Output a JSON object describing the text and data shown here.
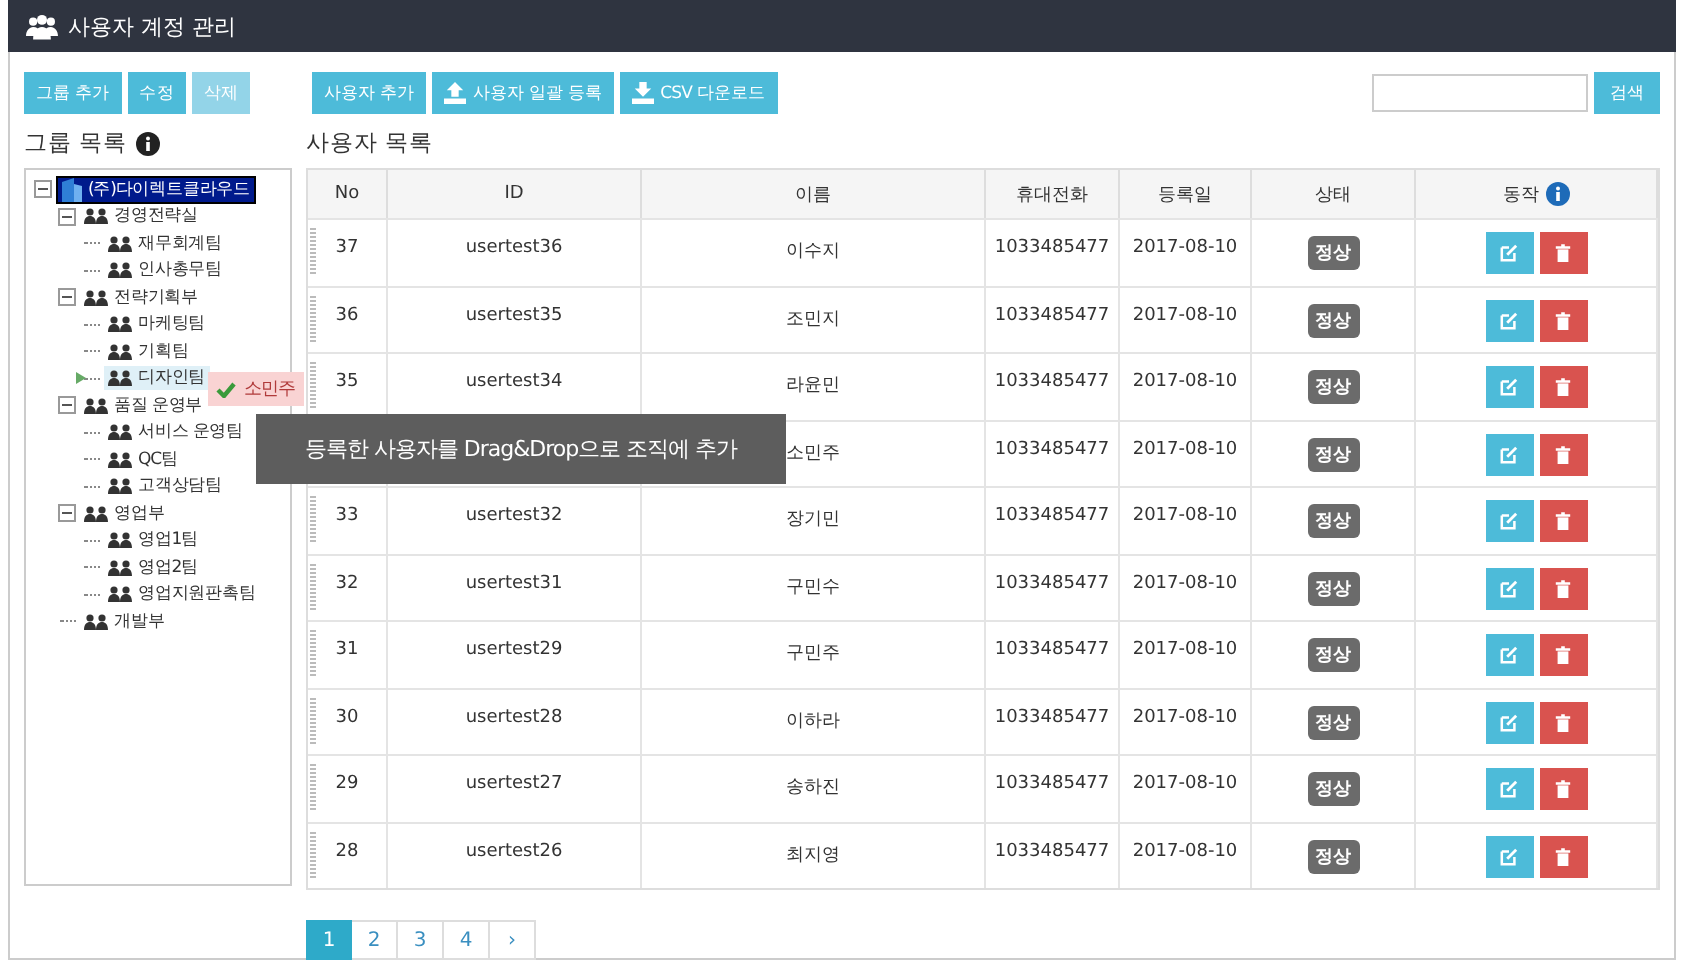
{
  "window": {
    "title": "사용자 계정 관리"
  },
  "group_toolbar": [
    {
      "label": "그룹 추가",
      "disabled": false
    },
    {
      "label": "수정",
      "disabled": false
    },
    {
      "label": "삭제",
      "disabled": true
    }
  ],
  "user_toolbar": [
    {
      "label": "사용자 추가",
      "kind": "plain"
    },
    {
      "label": "사용자 일괄 등록",
      "kind": "upload"
    },
    {
      "label": "CSV 다운로드",
      "kind": "download"
    }
  ],
  "search": {
    "button": "검색"
  },
  "group_panel": {
    "title": "그룹 목록",
    "tree": [
      {
        "label": "(주)다이렉트클라우드",
        "kind": "company",
        "selected": true,
        "highlighted": false,
        "children": [
          {
            "label": "경영전략실",
            "kind": "group",
            "selected": false,
            "highlighted": false,
            "children": [
              {
                "label": "재무회계팀",
                "kind": "group",
                "selected": false,
                "highlighted": false
              },
              {
                "label": "인사총무팀",
                "kind": "group",
                "selected": false,
                "highlighted": false
              }
            ]
          },
          {
            "label": "전략기획부",
            "kind": "group",
            "selected": false,
            "highlighted": false,
            "children": [
              {
                "label": "마케팅팀",
                "kind": "group",
                "selected": false,
                "highlighted": false
              },
              {
                "label": "기획팀",
                "kind": "group",
                "selected": false,
                "highlighted": false
              },
              {
                "label": "디자인팀",
                "kind": "group",
                "selected": false,
                "highlighted": true
              }
            ]
          },
          {
            "label": "품질 운영부",
            "kind": "group",
            "selected": false,
            "highlighted": false,
            "children": [
              {
                "label": "서비스 운영팀",
                "kind": "group",
                "selected": false,
                "highlighted": false
              },
              {
                "label": "QC팀",
                "kind": "group",
                "selected": false,
                "highlighted": false
              },
              {
                "label": "고객상담팀",
                "kind": "group",
                "selected": false,
                "highlighted": false
              }
            ]
          },
          {
            "label": "영업부",
            "kind": "group",
            "selected": false,
            "highlighted": false,
            "children": [
              {
                "label": "영업1팀",
                "kind": "group",
                "selected": false,
                "highlighted": false
              },
              {
                "label": "영업2팀",
                "kind": "group",
                "selected": false,
                "highlighted": false
              },
              {
                "label": "영업지원판촉팀",
                "kind": "group",
                "selected": false,
                "highlighted": false
              }
            ]
          },
          {
            "label": "개발부",
            "kind": "group",
            "selected": false,
            "highlighted": false
          }
        ]
      }
    ]
  },
  "drag_ghost": {
    "label": "소민주"
  },
  "user_panel": {
    "title": "사용자 목록",
    "columns": [
      "No",
      "ID",
      "이름",
      "휴대전화",
      "등록일",
      "상태",
      "동작"
    ],
    "rows": [
      {
        "no": "37",
        "id": "usertest36",
        "name": "이수지",
        "phone": "1033485477",
        "date": "2017-08-10",
        "status": "정상"
      },
      {
        "no": "36",
        "id": "usertest35",
        "name": "조민지",
        "phone": "1033485477",
        "date": "2017-08-10",
        "status": "정상"
      },
      {
        "no": "35",
        "id": "usertest34",
        "name": "라윤민",
        "phone": "1033485477",
        "date": "2017-08-10",
        "status": "정상"
      },
      {
        "name": "소민주",
        "phone": "1033485477",
        "date": "2017-08-10",
        "status": "정상"
      },
      {
        "no": "33",
        "id": "usertest32",
        "name": "장기민",
        "phone": "1033485477",
        "date": "2017-08-10",
        "status": "정상"
      },
      {
        "no": "32",
        "id": "usertest31",
        "name": "구민수",
        "phone": "1033485477",
        "date": "2017-08-10",
        "status": "정상"
      },
      {
        "no": "31",
        "id": "usertest29",
        "name": "구민주",
        "phone": "1033485477",
        "date": "2017-08-10",
        "status": "정상"
      },
      {
        "no": "30",
        "id": "usertest28",
        "name": "이하라",
        "phone": "1033485477",
        "date": "2017-08-10",
        "status": "정상"
      },
      {
        "no": "29",
        "id": "usertest27",
        "name": "송하진",
        "phone": "1033485477",
        "date": "2017-08-10",
        "status": "정상"
      },
      {
        "no": "28",
        "id": "usertest26",
        "name": "최지영",
        "phone": "1033485477",
        "date": "2017-08-10",
        "status": "정상"
      }
    ]
  },
  "tooltip": "등록한 사용자를 Drag&Drop으로 조직에 추가",
  "pagination": {
    "pages": [
      {
        "label": "1",
        "selected": true
      },
      {
        "label": "2",
        "selected": false
      },
      {
        "label": "3",
        "selected": false
      },
      {
        "label": "4",
        "selected": false
      }
    ],
    "next": "›"
  }
}
